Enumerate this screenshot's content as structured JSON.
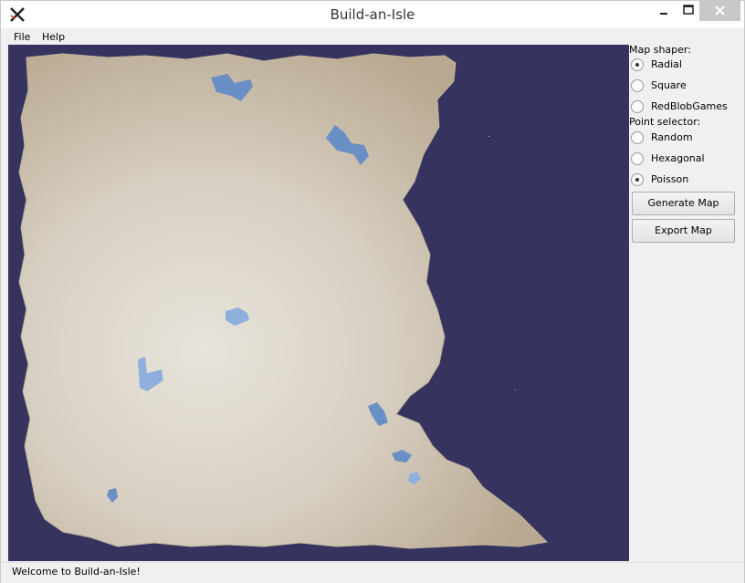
{
  "window": {
    "title": "Build-an-Isle"
  },
  "menubar": {
    "items": [
      "File",
      "Help"
    ]
  },
  "panel": {
    "map_shaper_label": "Map shaper:",
    "map_shaper_options": [
      {
        "label": "Radial",
        "checked": true
      },
      {
        "label": "Square",
        "checked": false
      },
      {
        "label": "RedBlobGames",
        "checked": false
      }
    ],
    "point_selector_label": "Point selector:",
    "point_selector_options": [
      {
        "label": "Random",
        "checked": false
      },
      {
        "label": "Hexagonal",
        "checked": false
      },
      {
        "label": "Poisson",
        "checked": true
      }
    ],
    "generate_label": "Generate Map",
    "export_label": "Export Map"
  },
  "map": {
    "ocean_color": "#36335f",
    "land_color": "#c9bca9",
    "lake_color": "#6a8fc4"
  },
  "status": {
    "text": "Welcome to Build-an-Isle!"
  }
}
